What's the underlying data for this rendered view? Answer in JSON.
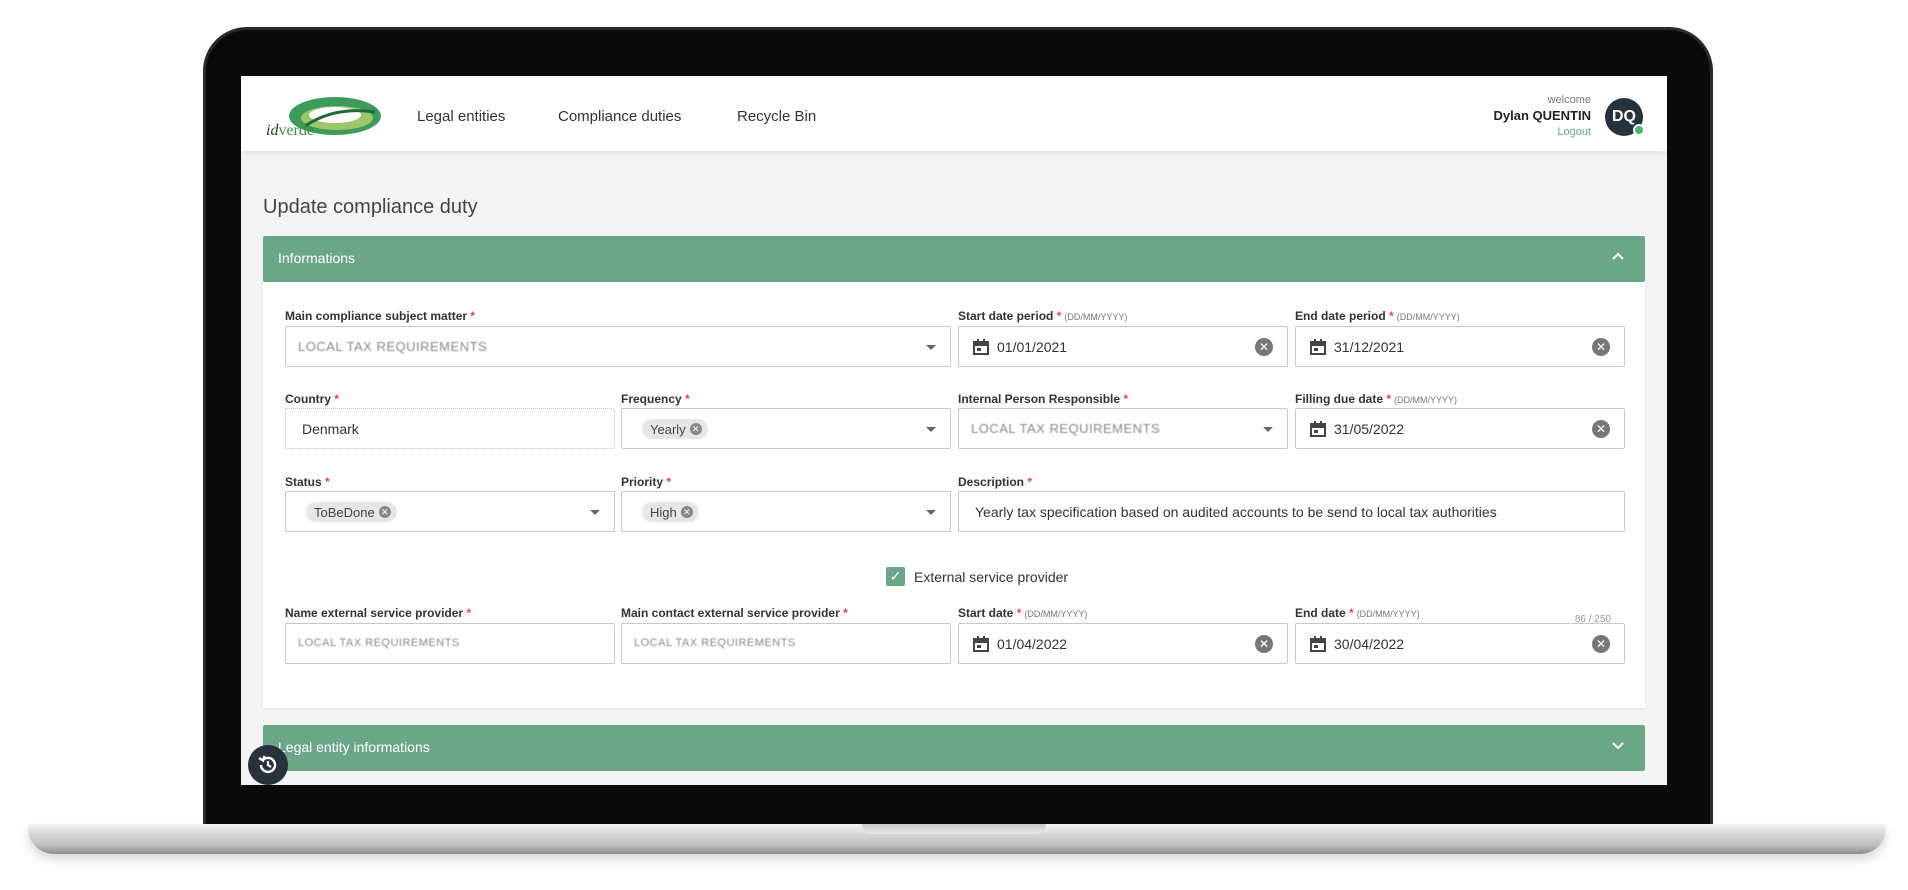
{
  "header": {
    "logo_prefix": "id",
    "logo_suffix": "verde",
    "nav": [
      "Legal entities",
      "Compliance duties",
      "Recycle Bin"
    ],
    "welcome": "welcome",
    "user_name": "Dylan QUENTIN",
    "logout": "Logout",
    "avatar_initials": "DQ"
  },
  "page_title": "Update compliance duty",
  "panels": {
    "informations": "Informations",
    "legal_entity": "Legal entity informations"
  },
  "fields": {
    "main_subject": {
      "label": "Main compliance subject matter",
      "value": "LOCAL TAX REQUIREMENTS"
    },
    "start_period": {
      "label": "Start date period",
      "format": "(DD/MM/YYYY)",
      "value": "01/01/2021"
    },
    "end_period": {
      "label": "End date period",
      "format": "(DD/MM/YYYY)",
      "value": "31/12/2021"
    },
    "country": {
      "label": "Country",
      "value": "Denmark"
    },
    "frequency": {
      "label": "Frequency",
      "value": "Yearly"
    },
    "internal_person": {
      "label": "Internal Person Responsible",
      "value": "LOCAL TAX REQUIREMENTS"
    },
    "filling_due": {
      "label": "Filling due date",
      "format": "(DD/MM/YYYY)",
      "value": "31/05/2022"
    },
    "status": {
      "label": "Status",
      "value": "ToBeDone"
    },
    "priority": {
      "label": "Priority",
      "value": "High"
    },
    "description": {
      "label": "Description",
      "value": "Yearly tax specification based on audited accounts to be send to local tax authorities",
      "counter": "86 / 250"
    },
    "external_checkbox": {
      "label": "External service provider",
      "checked": true
    },
    "name_external": {
      "label": "Name external service provider",
      "value": "LOCAL TAX REQUIREMENTS"
    },
    "main_contact_external": {
      "label": "Main contact external service provider",
      "value": "LOCAL TAX REQUIREMENTS"
    },
    "start_date": {
      "label": "Start date",
      "format": "(DD/MM/YYYY)",
      "value": "01/04/2022"
    },
    "end_date": {
      "label": "End date",
      "format": "(DD/MM/YYYY)",
      "value": "30/04/2022"
    }
  },
  "required_marker": "*",
  "clear_glyph": "✕",
  "chip_glyph": "✕",
  "check_glyph": "✓",
  "colors": {
    "accent": "#6aa687",
    "avatar": "#27323d",
    "required": "#e04848"
  }
}
